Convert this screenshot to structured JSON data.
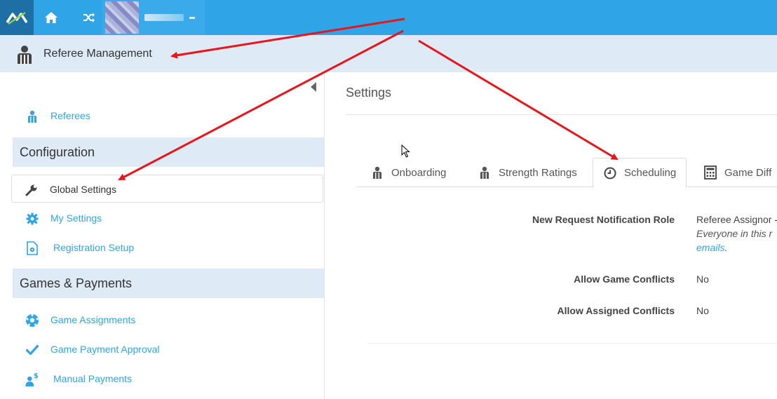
{
  "module": {
    "title": "Referee Management"
  },
  "sidebar": {
    "top_items": [
      {
        "label": "Referees"
      }
    ],
    "sections": [
      {
        "title": "Configuration",
        "items": [
          {
            "label": "Global Settings"
          },
          {
            "label": "My Settings"
          },
          {
            "label": "Registration Setup"
          }
        ]
      },
      {
        "title": "Games & Payments",
        "items": [
          {
            "label": "Game Assignments"
          },
          {
            "label": "Game Payment Approval"
          },
          {
            "label": "Manual Payments"
          }
        ]
      }
    ]
  },
  "main": {
    "title": "Settings",
    "tabs": [
      {
        "label": "Onboarding",
        "icon": "referee-icon"
      },
      {
        "label": "Strength Ratings",
        "icon": "referee-icon"
      },
      {
        "label": "Scheduling",
        "icon": "clock-icon"
      },
      {
        "label": "Game Diff",
        "icon": "calculator-icon"
      }
    ],
    "fields": [
      {
        "label": "New Request Notification Role",
        "value": "Referee Assignor -",
        "note": "Everyone in this r",
        "link": "emails",
        "link_suffix": "."
      },
      {
        "label": "Allow Game Conflicts",
        "value": "No"
      },
      {
        "label": "Allow Assigned Conflicts",
        "value": "No"
      }
    ]
  },
  "colors": {
    "accent": "#2fa4e7",
    "topbar": "#2fa4e7",
    "header_bg": "#dfeaf7",
    "annotation_arrow": "#e8151b"
  }
}
